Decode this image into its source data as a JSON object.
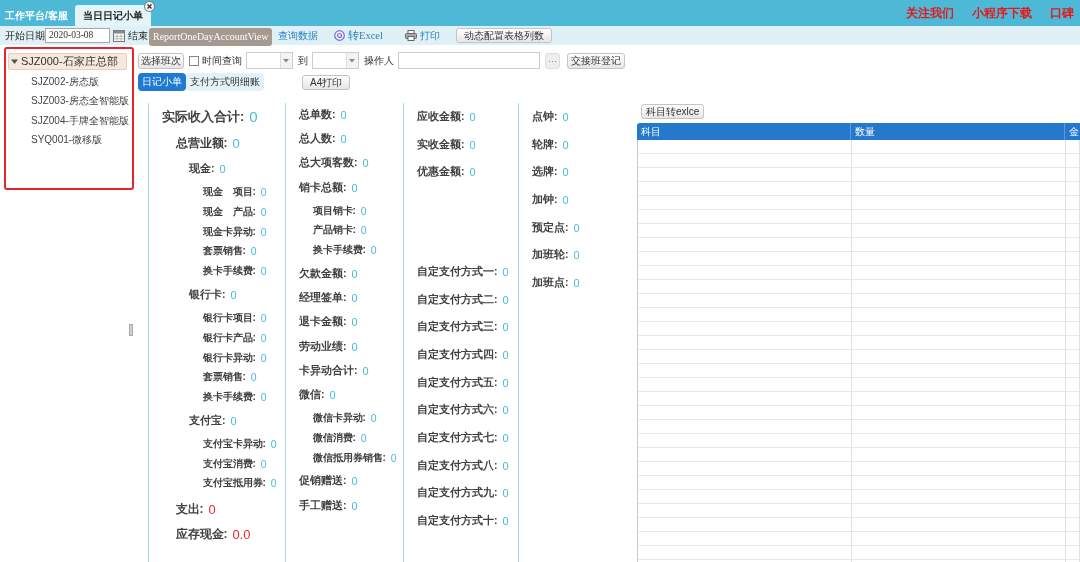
{
  "top_tabs": [
    {
      "label": "工作平台/客服",
      "selected": false,
      "closable": false
    },
    {
      "label": "当日日记小单",
      "selected": true,
      "closable": true
    }
  ],
  "header_links": [
    "关注我们",
    "小程序下载",
    "口碑"
  ],
  "toolbar": {
    "start_label": "开始日期",
    "start_date": "2020-03-08",
    "end_label": "结束",
    "query": "查询数据",
    "excel": "转Excel",
    "print": "打印",
    "config_button": "动态配置表格列数"
  },
  "tooltip": "ReportOneDayAccountView",
  "tree": [
    {
      "label": "SJZ000-石家庄总部",
      "expanded": true,
      "selected": true,
      "children": [
        {
          "label": "SJZ002-房态版",
          "selected": false
        },
        {
          "label": "SJZ003-房态全智能版",
          "selected": false
        },
        {
          "label": "SJZ004-手牌全智能版",
          "selected": false
        },
        {
          "label": "SYQ001-微移版",
          "selected": false
        }
      ]
    }
  ],
  "filters": {
    "shift_button": "选择班次",
    "time_query": {
      "label": "时间查询",
      "checked": false
    },
    "to_label": "到",
    "operator_label": "操作人",
    "more_button": "···",
    "handover_button": "交接班登记"
  },
  "report_tabs": [
    {
      "label": "日记小单",
      "selected": true
    },
    {
      "label": "支付方式明细账",
      "selected": false
    }
  ],
  "print_button": "A4打印",
  "summary_columns": [
    {
      "sections": [
        [
          {
            "label": "实际收入合计:",
            "value": "0",
            "kind": "headline",
            "children": [
              {
                "label": "总营业额:",
                "value": "0",
                "kind": "subtotal",
                "color": "#4cb9dc",
                "children": [
                  {
                    "label": "现金:",
                    "value": "0",
                    "kind": "field",
                    "children": [
                      {
                        "label": "现金　项目:",
                        "value": "0",
                        "kind": "detail"
                      },
                      {
                        "label": "现金　产品:",
                        "value": "0",
                        "kind": "detail"
                      },
                      {
                        "label": "现金卡异动:",
                        "value": "0",
                        "kind": "detail"
                      },
                      {
                        "label": "套票销售:",
                        "value": "0",
                        "kind": "detail"
                      },
                      {
                        "label": "换卡手续费:",
                        "value": "0",
                        "kind": "detail"
                      }
                    ]
                  },
                  {
                    "label": "银行卡:",
                    "value": "0",
                    "kind": "field",
                    "children": [
                      {
                        "label": "银行卡项目:",
                        "value": "0",
                        "kind": "detail"
                      },
                      {
                        "label": "银行卡产品:",
                        "value": "0",
                        "kind": "detail"
                      },
                      {
                        "label": "银行卡异动:",
                        "value": "0",
                        "kind": "detail"
                      },
                      {
                        "label": "套票销售:",
                        "value": "0",
                        "kind": "detail"
                      },
                      {
                        "label": "换卡手续费:",
                        "value": "0",
                        "kind": "detail"
                      }
                    ]
                  },
                  {
                    "label": "支付宝:",
                    "value": "0",
                    "kind": "field",
                    "children": [
                      {
                        "label": "支付宝卡异动:",
                        "value": "0",
                        "kind": "detail"
                      },
                      {
                        "label": "支付宝消费:",
                        "value": "0",
                        "kind": "detail"
                      },
                      {
                        "label": "支付宝抵用券:",
                        "value": "0",
                        "kind": "detail"
                      }
                    ]
                  }
                ]
              },
              {
                "label": "支出:",
                "value": "0",
                "kind": "subtotal",
                "color": "#e8262b"
              },
              {
                "label": "应存现金:",
                "value": "0.0",
                "kind": "subtotal",
                "color": "#e8262b"
              }
            ]
          }
        ]
      ]
    },
    {
      "sections": [
        [
          {
            "label": "总单数:",
            "value": "0",
            "kind": "field"
          },
          {
            "label": "总人数:",
            "value": "0",
            "kind": "field"
          },
          {
            "label": "总大项客数:",
            "value": "0",
            "kind": "field"
          },
          {
            "label": "销卡总额:",
            "value": "0",
            "kind": "field",
            "children": [
              {
                "label": "项目销卡:",
                "value": "0",
                "kind": "detail"
              },
              {
                "label": "产品销卡:",
                "value": "0",
                "kind": "detail"
              },
              {
                "label": "换卡手续费:",
                "value": "0",
                "kind": "detail"
              }
            ]
          },
          {
            "label": "欠款金额:",
            "value": "0",
            "kind": "field"
          },
          {
            "label": "经理签单:",
            "value": "0",
            "kind": "field"
          },
          {
            "label": "退卡金额:",
            "value": "0",
            "kind": "field"
          },
          {
            "label": "劳动业绩:",
            "value": "0",
            "kind": "field"
          },
          {
            "label": "卡异动合计:",
            "value": "0",
            "kind": "field"
          },
          {
            "label": "微信:",
            "value": "0",
            "kind": "field",
            "children": [
              {
                "label": "微信卡异动:",
                "value": "0",
                "kind": "detail"
              },
              {
                "label": "微信消费:",
                "value": "0",
                "kind": "detail"
              },
              {
                "label": "微信抵用券销售:",
                "value": "0",
                "kind": "detail"
              }
            ]
          },
          {
            "label": "促销赠送:",
            "value": "0",
            "kind": "field"
          },
          {
            "label": "手工赠送:",
            "value": "0",
            "kind": "field"
          }
        ]
      ]
    },
    {
      "sections": [
        [
          {
            "label": "应收金额:",
            "value": "0",
            "kind": "field"
          },
          {
            "label": "实收金额:",
            "value": "0",
            "kind": "field"
          },
          {
            "label": "优惠金额:",
            "value": "0",
            "kind": "field"
          }
        ],
        [
          {
            "label": "自定支付方式一:",
            "value": "0",
            "kind": "field"
          },
          {
            "label": "自定支付方式二:",
            "value": "0",
            "kind": "field"
          },
          {
            "label": "自定支付方式三:",
            "value": "0",
            "kind": "field"
          },
          {
            "label": "自定支付方式四:",
            "value": "0",
            "kind": "field"
          },
          {
            "label": "自定支付方式五:",
            "value": "0",
            "kind": "field"
          },
          {
            "label": "自定支付方式六:",
            "value": "0",
            "kind": "field"
          },
          {
            "label": "自定支付方式七:",
            "value": "0",
            "kind": "field"
          },
          {
            "label": "自定支付方式八:",
            "value": "0",
            "kind": "field"
          },
          {
            "label": "自定支付方式九:",
            "value": "0",
            "kind": "field"
          },
          {
            "label": "自定支付方式十:",
            "value": "0",
            "kind": "field"
          }
        ]
      ]
    },
    {
      "sections": [
        [
          {
            "label": "点钟:",
            "value": "0",
            "kind": "field"
          },
          {
            "label": "轮牌:",
            "value": "0",
            "kind": "field"
          },
          {
            "label": "选牌:",
            "value": "0",
            "kind": "field"
          },
          {
            "label": "加钟:",
            "value": "0",
            "kind": "field"
          },
          {
            "label": "预定点:",
            "value": "0",
            "kind": "field"
          },
          {
            "label": "加班轮:",
            "value": "0",
            "kind": "field"
          },
          {
            "label": "加班点:",
            "value": "0",
            "kind": "field"
          }
        ]
      ]
    }
  ],
  "subject_table": {
    "export_button": "科目转exlce",
    "columns": [
      "科目",
      "数量",
      "金"
    ]
  }
}
